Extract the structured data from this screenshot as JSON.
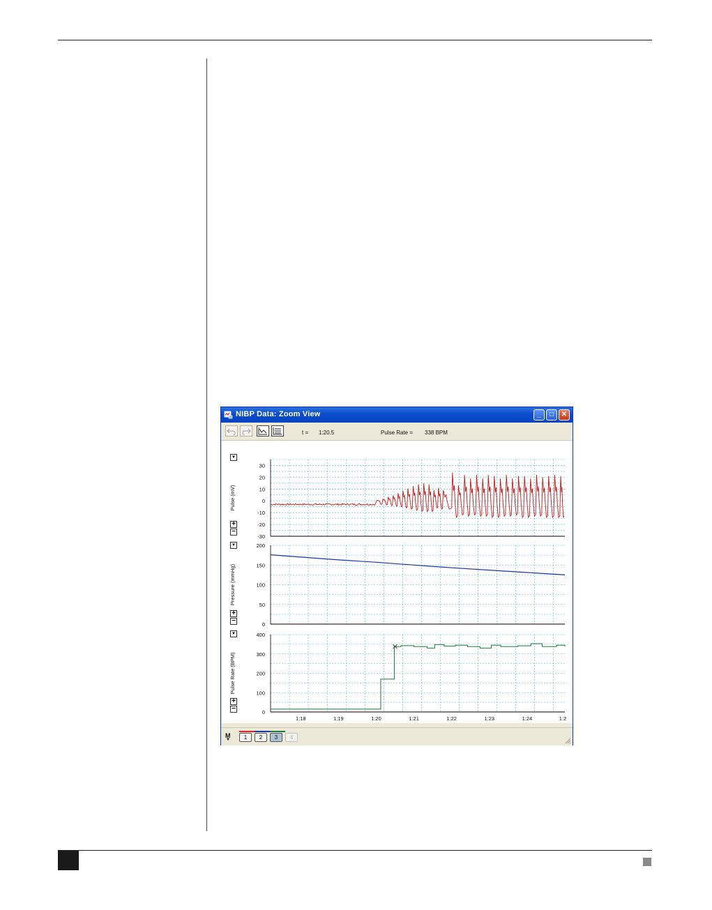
{
  "window": {
    "title": "NIBP Data: Zoom View",
    "controls": {
      "minimize": "_",
      "maximize": "□",
      "close": "✕"
    }
  },
  "toolbar": {
    "icons": [
      "undo-icon",
      "redo-icon",
      "autoscale-icon",
      "overlap-icon"
    ],
    "time_label": "t =",
    "time_value": "1:20.5",
    "rate_label": "Pulse Rate =",
    "rate_value": "338 BPM"
  },
  "panels": {
    "pulse": {
      "plus": "+",
      "minus": "−"
    },
    "pressure": {
      "plus": "+",
      "minus": "−"
    },
    "rate": {
      "plus": "+",
      "minus": "−"
    }
  },
  "bottom": {
    "mode_label": "M",
    "channels": [
      {
        "label": "1",
        "color": "#e02020",
        "state": "normal"
      },
      {
        "label": "2",
        "color": "#1c33a8",
        "state": "normal"
      },
      {
        "label": "3",
        "color": "#1e7a3c",
        "state": "selected"
      },
      {
        "label": "4",
        "color": "",
        "state": "disabled"
      }
    ]
  },
  "chart_data": [
    {
      "type": "line",
      "ylabel": "Pulse (mV)",
      "ylim": [
        -30,
        35
      ],
      "yticks": [
        "30",
        "20",
        "10",
        "0",
        "-10",
        "-20",
        "-30"
      ],
      "grid": true,
      "color": "#c41a1a",
      "baseline": -3,
      "beats": [
        {
          "x": 80.02,
          "amp": 0.5,
          "floor": -3
        },
        {
          "x": 80.18,
          "amp": 1.5,
          "floor": -3.5
        },
        {
          "x": 80.32,
          "amp": 3,
          "floor": -4
        },
        {
          "x": 80.45,
          "amp": 4.5,
          "floor": -4.5
        },
        {
          "x": 80.58,
          "amp": 6.5,
          "floor": -5
        },
        {
          "x": 80.71,
          "amp": 8.5,
          "floor": -6
        },
        {
          "x": 80.84,
          "amp": 10.5,
          "floor": -7
        },
        {
          "x": 80.98,
          "amp": 12.5,
          "floor": -8
        },
        {
          "x": 81.12,
          "amp": 14,
          "floor": -9
        },
        {
          "x": 81.26,
          "amp": 15,
          "floor": -9
        },
        {
          "x": 81.4,
          "amp": 14,
          "floor": -9
        },
        {
          "x": 81.53,
          "amp": 9,
          "floor": -6
        },
        {
          "x": 81.65,
          "amp": 11,
          "floor": -7
        },
        {
          "x": 81.78,
          "amp": 9,
          "floor": -7
        },
        {
          "x": 82.02,
          "amp": 24,
          "floor": -14
        },
        {
          "x": 82.18,
          "amp": 13,
          "floor": -12
        },
        {
          "x": 82.34,
          "amp": 22,
          "floor": -13
        },
        {
          "x": 82.5,
          "amp": 19,
          "floor": -12
        },
        {
          "x": 82.66,
          "amp": 22,
          "floor": -13
        },
        {
          "x": 82.82,
          "amp": 19,
          "floor": -13
        },
        {
          "x": 82.97,
          "amp": 22,
          "floor": -14
        },
        {
          "x": 83.13,
          "amp": 21,
          "floor": -14
        },
        {
          "x": 83.29,
          "amp": 19,
          "floor": -13
        },
        {
          "x": 83.45,
          "amp": 22,
          "floor": -13
        },
        {
          "x": 83.61,
          "amp": 19,
          "floor": -12
        },
        {
          "x": 83.77,
          "amp": 21,
          "floor": -14
        },
        {
          "x": 83.93,
          "amp": 21,
          "floor": -14
        },
        {
          "x": 84.09,
          "amp": 19,
          "floor": -13
        },
        {
          "x": 84.25,
          "amp": 22,
          "floor": -13
        },
        {
          "x": 84.41,
          "amp": 20,
          "floor": -14
        },
        {
          "x": 84.57,
          "amp": 21,
          "floor": -14
        },
        {
          "x": 84.73,
          "amp": 22,
          "floor": -14
        },
        {
          "x": 84.89,
          "amp": 21,
          "floor": -14
        }
      ]
    },
    {
      "type": "line",
      "ylabel": "Pressure (mmHg)",
      "ylim": [
        0,
        200
      ],
      "yticks": [
        "200",
        "150",
        "100",
        "50",
        "0"
      ],
      "grid": true,
      "color": "#1c33a8",
      "x": [
        77.0,
        78.0,
        79.0,
        80.0,
        81.0,
        82.0,
        83.0,
        84.0,
        85.0
      ],
      "y": [
        176,
        170,
        163,
        157,
        150,
        143,
        137,
        131,
        125
      ]
    },
    {
      "type": "line",
      "ylabel": "Pulse Rate (BPM)",
      "ylim": [
        0,
        400
      ],
      "yticks": [
        "400",
        "300",
        "200",
        "100",
        "0"
      ],
      "xticks": [
        "1:18",
        "1:19",
        "1:20",
        "1:21",
        "1:22",
        "1:23",
        "1:24",
        "1:2"
      ],
      "grid": true,
      "color": "#1e7a3c",
      "marker": {
        "x": 80.5,
        "y": 338
      },
      "steps": [
        [
          77.0,
          15
        ],
        [
          80.12,
          170
        ],
        [
          80.48,
          338
        ],
        [
          80.66,
          343
        ],
        [
          81.0,
          338
        ],
        [
          81.35,
          330
        ],
        [
          81.55,
          348
        ],
        [
          81.8,
          340
        ],
        [
          82.1,
          345
        ],
        [
          82.42,
          338
        ],
        [
          82.75,
          330
        ],
        [
          83.05,
          345
        ],
        [
          83.3,
          338
        ],
        [
          83.75,
          342
        ],
        [
          84.1,
          353
        ],
        [
          84.4,
          338
        ],
        [
          84.78,
          345
        ],
        [
          85.0,
          338
        ]
      ]
    }
  ]
}
